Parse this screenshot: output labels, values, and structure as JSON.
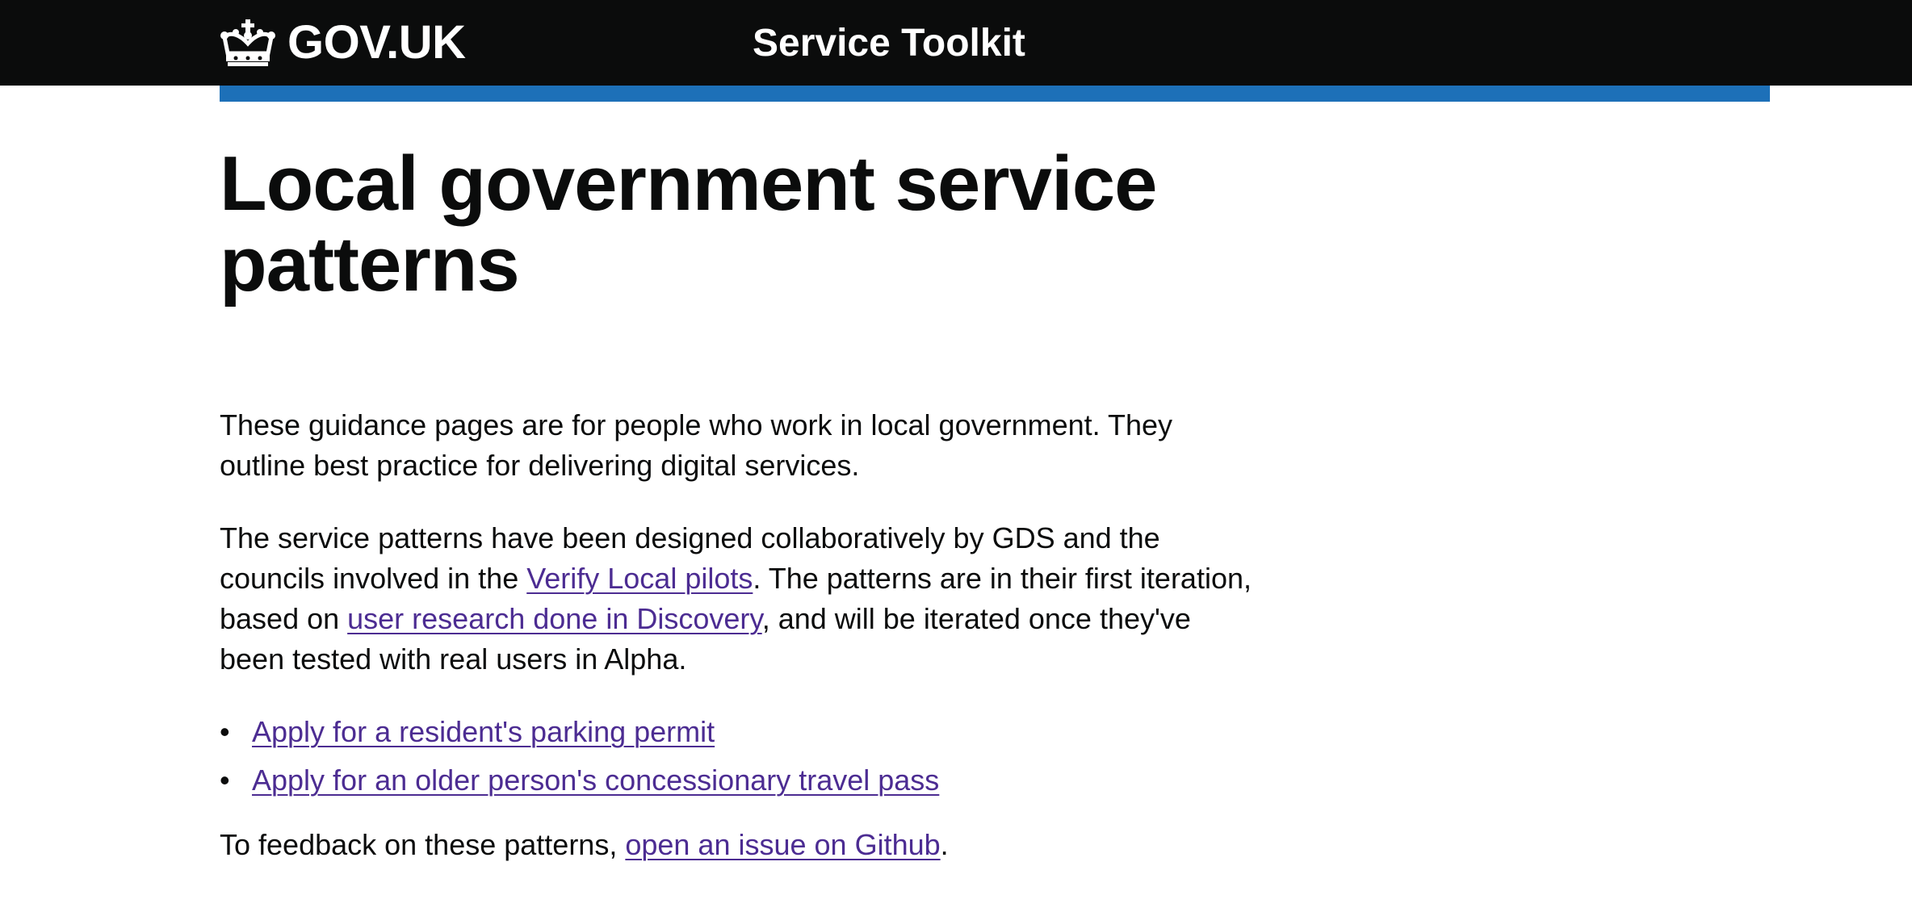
{
  "header": {
    "logo_text": "GOV.UK",
    "logo_icon": "crown-icon",
    "service_name": "Service Toolkit"
  },
  "colors": {
    "header_bg": "#0b0c0c",
    "accent_bar": "#1d70b8",
    "link": "#4c2c92",
    "text": "#0b0c0c"
  },
  "main": {
    "title": "Local government service patterns",
    "intro": "These guidance pages are for people who work in local government. They outline best practice for delivering digital services.",
    "para2": {
      "part1": "The service patterns have been designed collaboratively by GDS and the councils involved in the ",
      "link1": "Verify Local pilots",
      "part2": ". The patterns are in their first iteration, based on ",
      "link2": "user research done in Discovery",
      "part3": ", and will be iterated once they've been tested with real users in Alpha."
    },
    "patterns": [
      {
        "label": "Apply for a resident's parking permit"
      },
      {
        "label": "Apply for an older person's concessionary travel pass"
      }
    ],
    "feedback": {
      "prefix": "To feedback on these patterns, ",
      "link": "open an issue on Github",
      "suffix": "."
    }
  }
}
